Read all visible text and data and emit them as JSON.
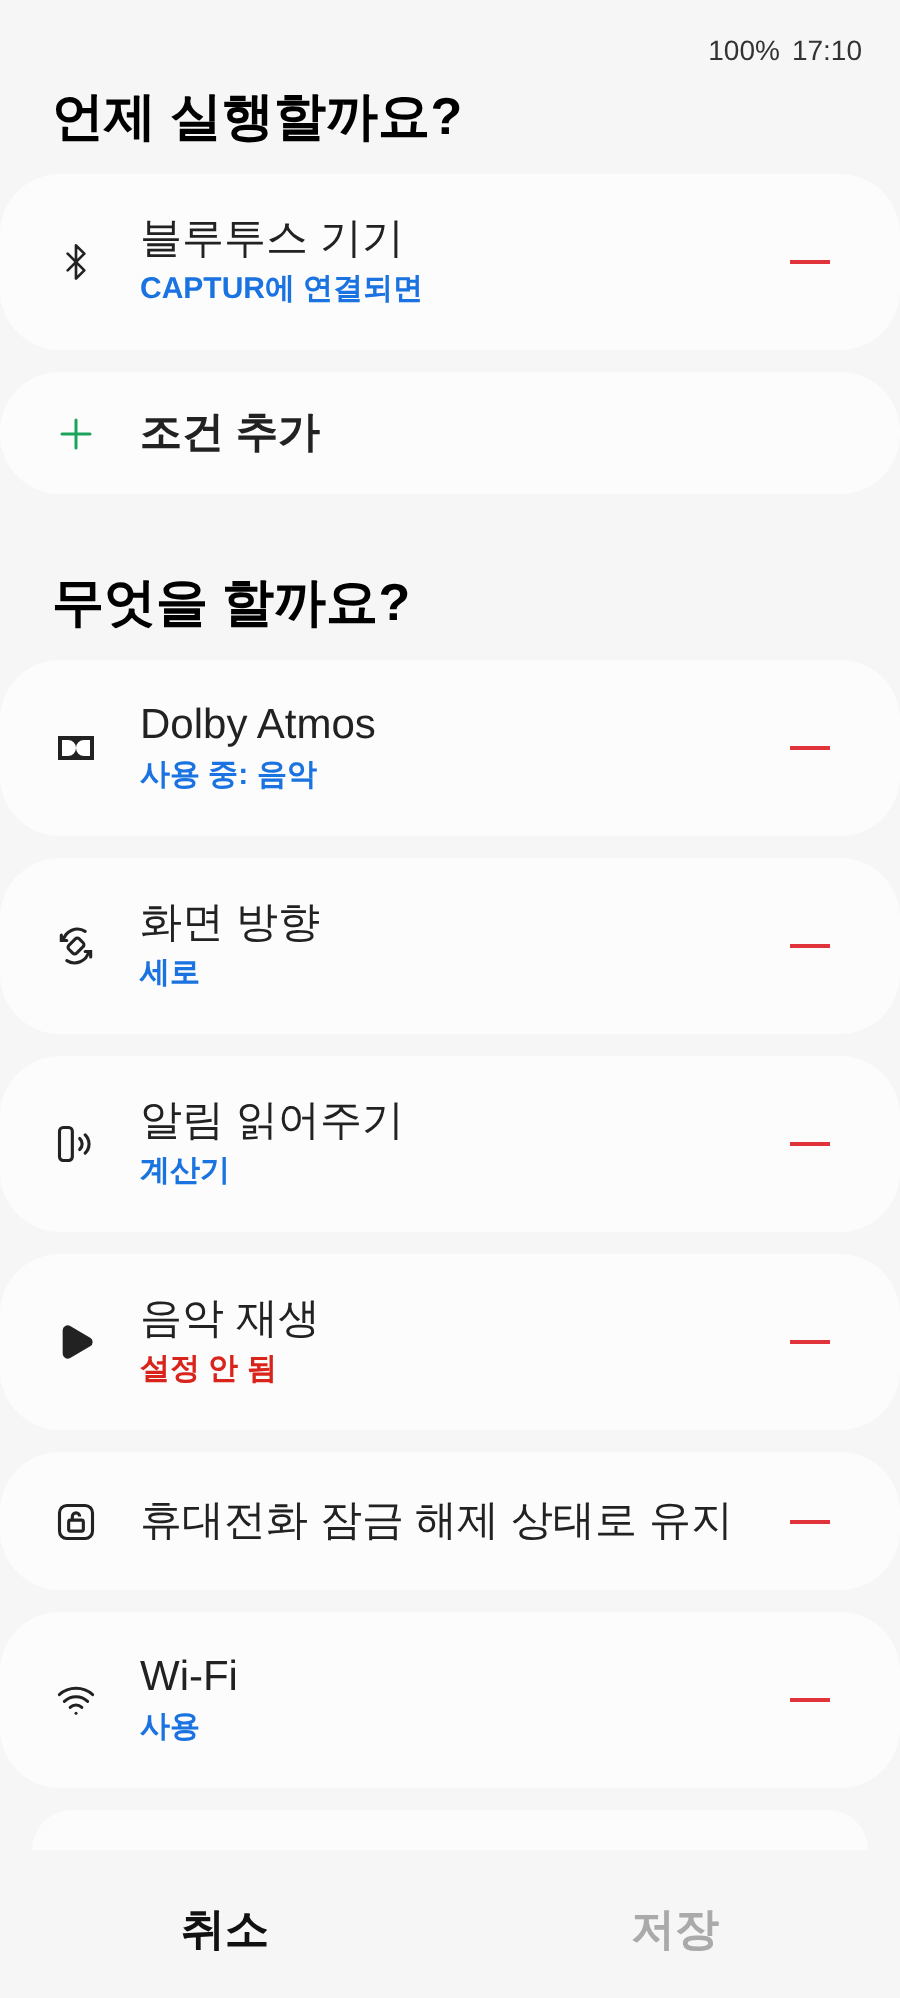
{
  "status_bar": {
    "battery": "100%",
    "time": "17:10"
  },
  "conditions": {
    "heading": "언제 실행할까요?",
    "items": [
      {
        "kind": "bluetooth",
        "title": "블루투스 기기",
        "subtitle": "CAPTUR에 연결되면",
        "color": "#1a73e0"
      }
    ],
    "add_label": "조건 추가"
  },
  "actions": {
    "heading": "무엇을 할까요?",
    "items": [
      {
        "kind": "dolby",
        "title": "Dolby Atmos",
        "subtitle": "사용 중: 음악",
        "color": "#1a73e0"
      },
      {
        "kind": "rotate",
        "title": "화면 방향",
        "subtitle": "세로",
        "color": "#1a73e0"
      },
      {
        "kind": "notify",
        "title": "알림 읽어주기",
        "subtitle": "계산기",
        "color": "#1a73e0"
      },
      {
        "kind": "play",
        "title": "음악 재생",
        "subtitle": "설정 안 됨",
        "color": "#d9241c"
      },
      {
        "kind": "lock",
        "title": "휴대전화 잠금 해제 상태로 유지"
      },
      {
        "kind": "wifi",
        "title": "Wi-Fi",
        "subtitle": "사용",
        "color": "#1a73e0"
      }
    ]
  },
  "bottom_bar": {
    "cancel": {
      "label": "취소",
      "disabled": false
    },
    "save": {
      "label": "저장",
      "disabled": true
    }
  }
}
